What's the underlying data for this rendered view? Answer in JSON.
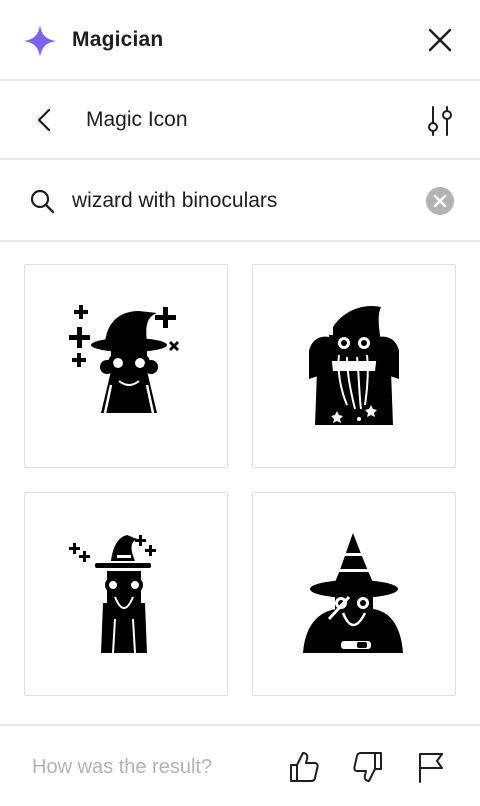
{
  "header": {
    "app_title": "Magician",
    "accent_color": "#7b61ff"
  },
  "subheader": {
    "title": "Magic Icon"
  },
  "search": {
    "value": "wizard with binoculars"
  },
  "results": [
    {
      "icon": "wizard-binoculars-sparkles-icon"
    },
    {
      "icon": "wizard-binoculars-beard-stars-icon"
    },
    {
      "icon": "wizard-small-binoculars-icon"
    },
    {
      "icon": "wizard-telescope-icon"
    }
  ],
  "footer": {
    "question": "How was the result?"
  }
}
